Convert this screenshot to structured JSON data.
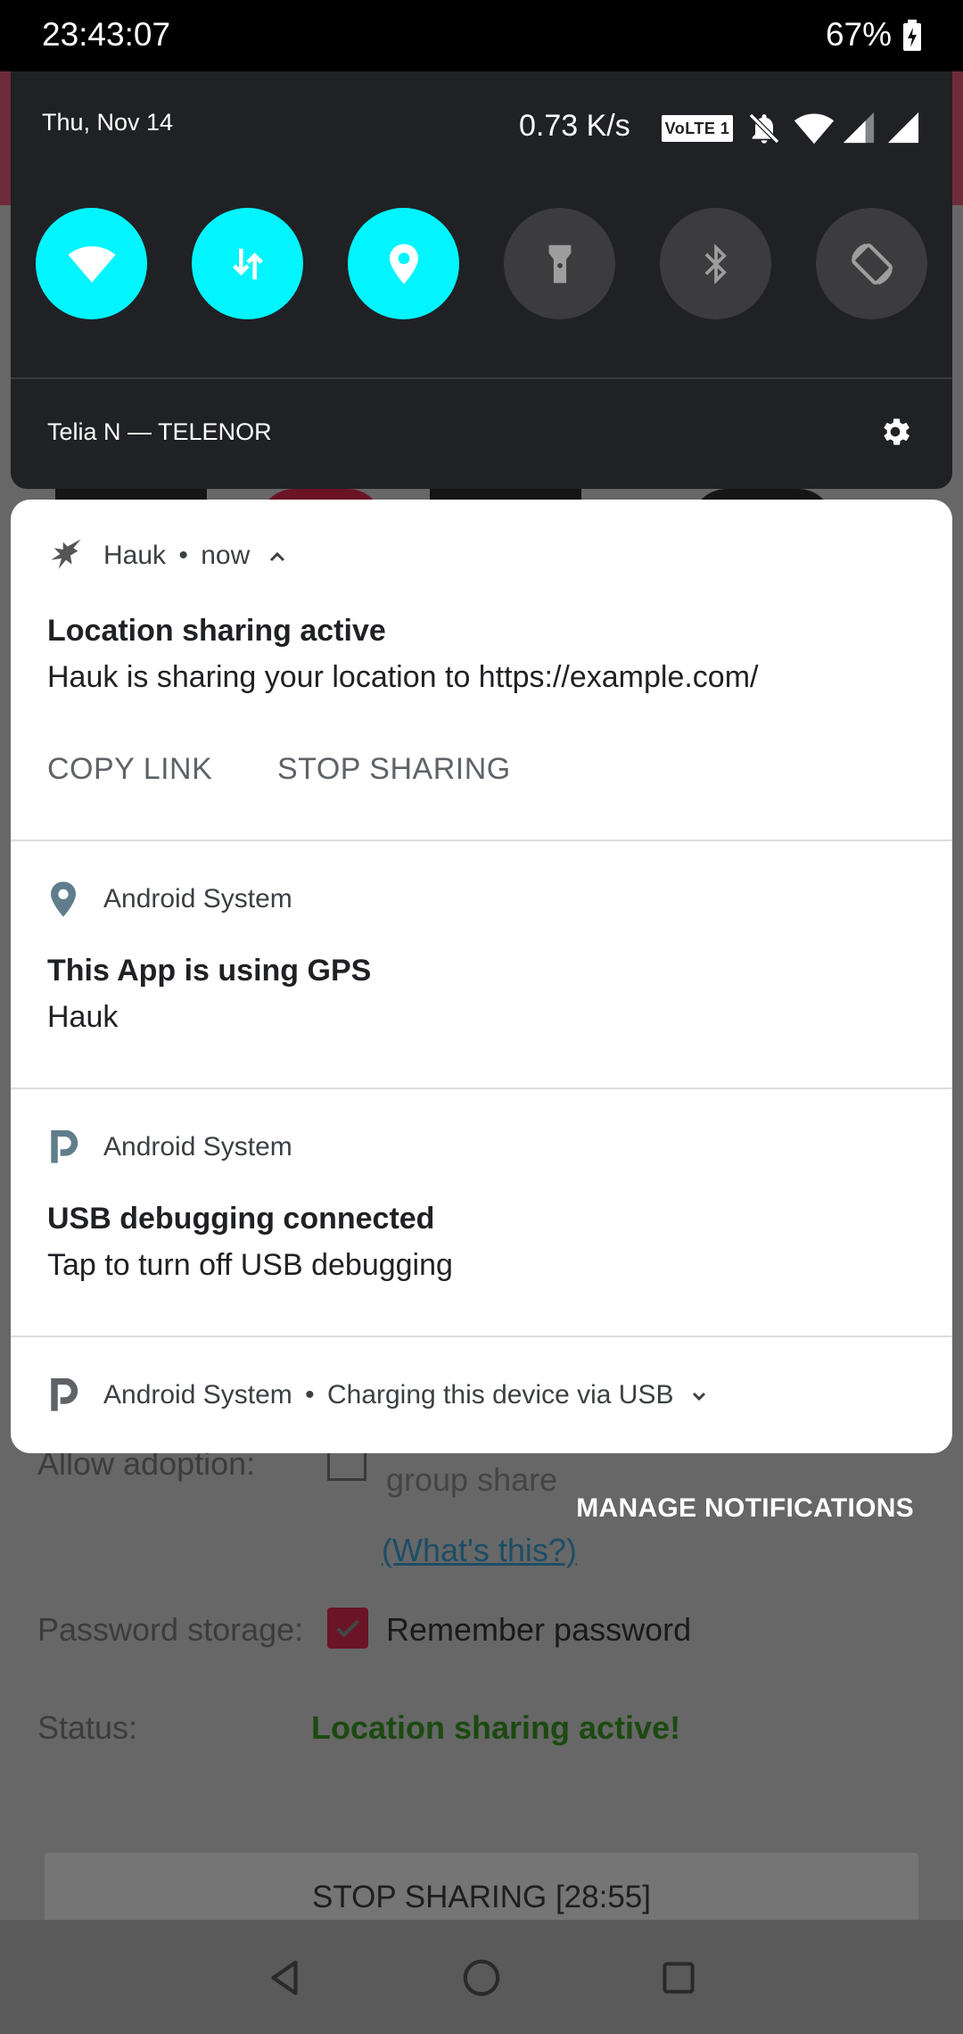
{
  "status_bar": {
    "time": "23:43:07",
    "battery_percent": "67%"
  },
  "quick_settings": {
    "date": "Thu, Nov 14",
    "network_speed": "0.73 K/s",
    "volte_badge": "VoLTE 1",
    "carrier": "Telia N — TELENOR",
    "tiles": [
      {
        "name": "wifi",
        "active": true
      },
      {
        "name": "mobile-data",
        "active": true
      },
      {
        "name": "location",
        "active": true
      },
      {
        "name": "flashlight",
        "active": false
      },
      {
        "name": "bluetooth",
        "active": false
      },
      {
        "name": "auto-rotate",
        "active": false
      }
    ],
    "accent_color": "#00f5ff"
  },
  "notifications": {
    "hauk": {
      "app_name": "Hauk",
      "time": "now",
      "title": "Location sharing active",
      "text": "Hauk is sharing your location to https://example.com/",
      "actions": [
        "COPY LINK",
        "STOP SHARING"
      ]
    },
    "gps": {
      "app_name": "Android System",
      "title": "This App is using GPS",
      "text": "Hauk"
    },
    "usb_debug": {
      "app_name": "Android System",
      "title": "USB debugging connected",
      "text": "Tap to turn off USB debugging"
    },
    "charging": {
      "app_name": "Android System",
      "summary": "Charging this device via USB"
    },
    "manage_label": "MANAGE NOTIFICATIONS"
  },
  "background_app": {
    "allow_adoption_label": "Allow adoption:",
    "group_share_text": "group share",
    "whats_this_link": "(What's this?)",
    "password_storage_label": "Password storage:",
    "remember_password_label": "Remember password",
    "status_label": "Status:",
    "status_value": "Location sharing active!",
    "stop_button_label": "STOP SHARING [28:55]",
    "brand_color": "#b00020",
    "status_color": "#1b8a1b"
  }
}
